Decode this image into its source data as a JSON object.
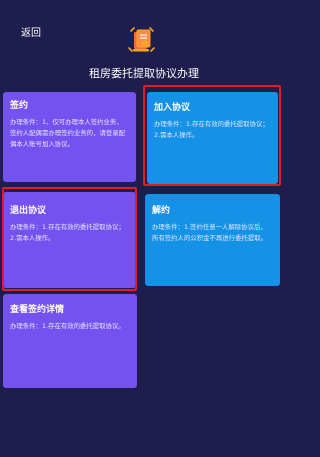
{
  "header": {
    "back_label": "返回",
    "title": "租房委托提取协议办理",
    "logo_icon": "document-stamp-icon"
  },
  "colors": {
    "background": "#1e1d4d",
    "purple_card": "#7452f0",
    "blue_card": "#1392e6",
    "highlight": "#e21b24"
  },
  "cards": {
    "sign": {
      "title": "签约",
      "desc": "办理条件：1、仅可办理本人签约业务，签约人配偶需办理签约业务的，请登录配偶本人账号加入协议。"
    },
    "join": {
      "title": "加入协议",
      "desc": "办理条件：1.存在有效的委托提取协议；2.需本人操作。"
    },
    "exit": {
      "title": "退出协议",
      "desc": "办理条件：1.存在有效的委托提取协议；2.需本人操作。"
    },
    "release": {
      "title": "解约",
      "desc": "办理条件：1.签约任意一人解除协议后，所有签约人的公积金不再进行委托提取。"
    },
    "detail": {
      "title": "查看签约详情",
      "desc": "办理条件：1.存在有效的委托提取协议。"
    }
  }
}
